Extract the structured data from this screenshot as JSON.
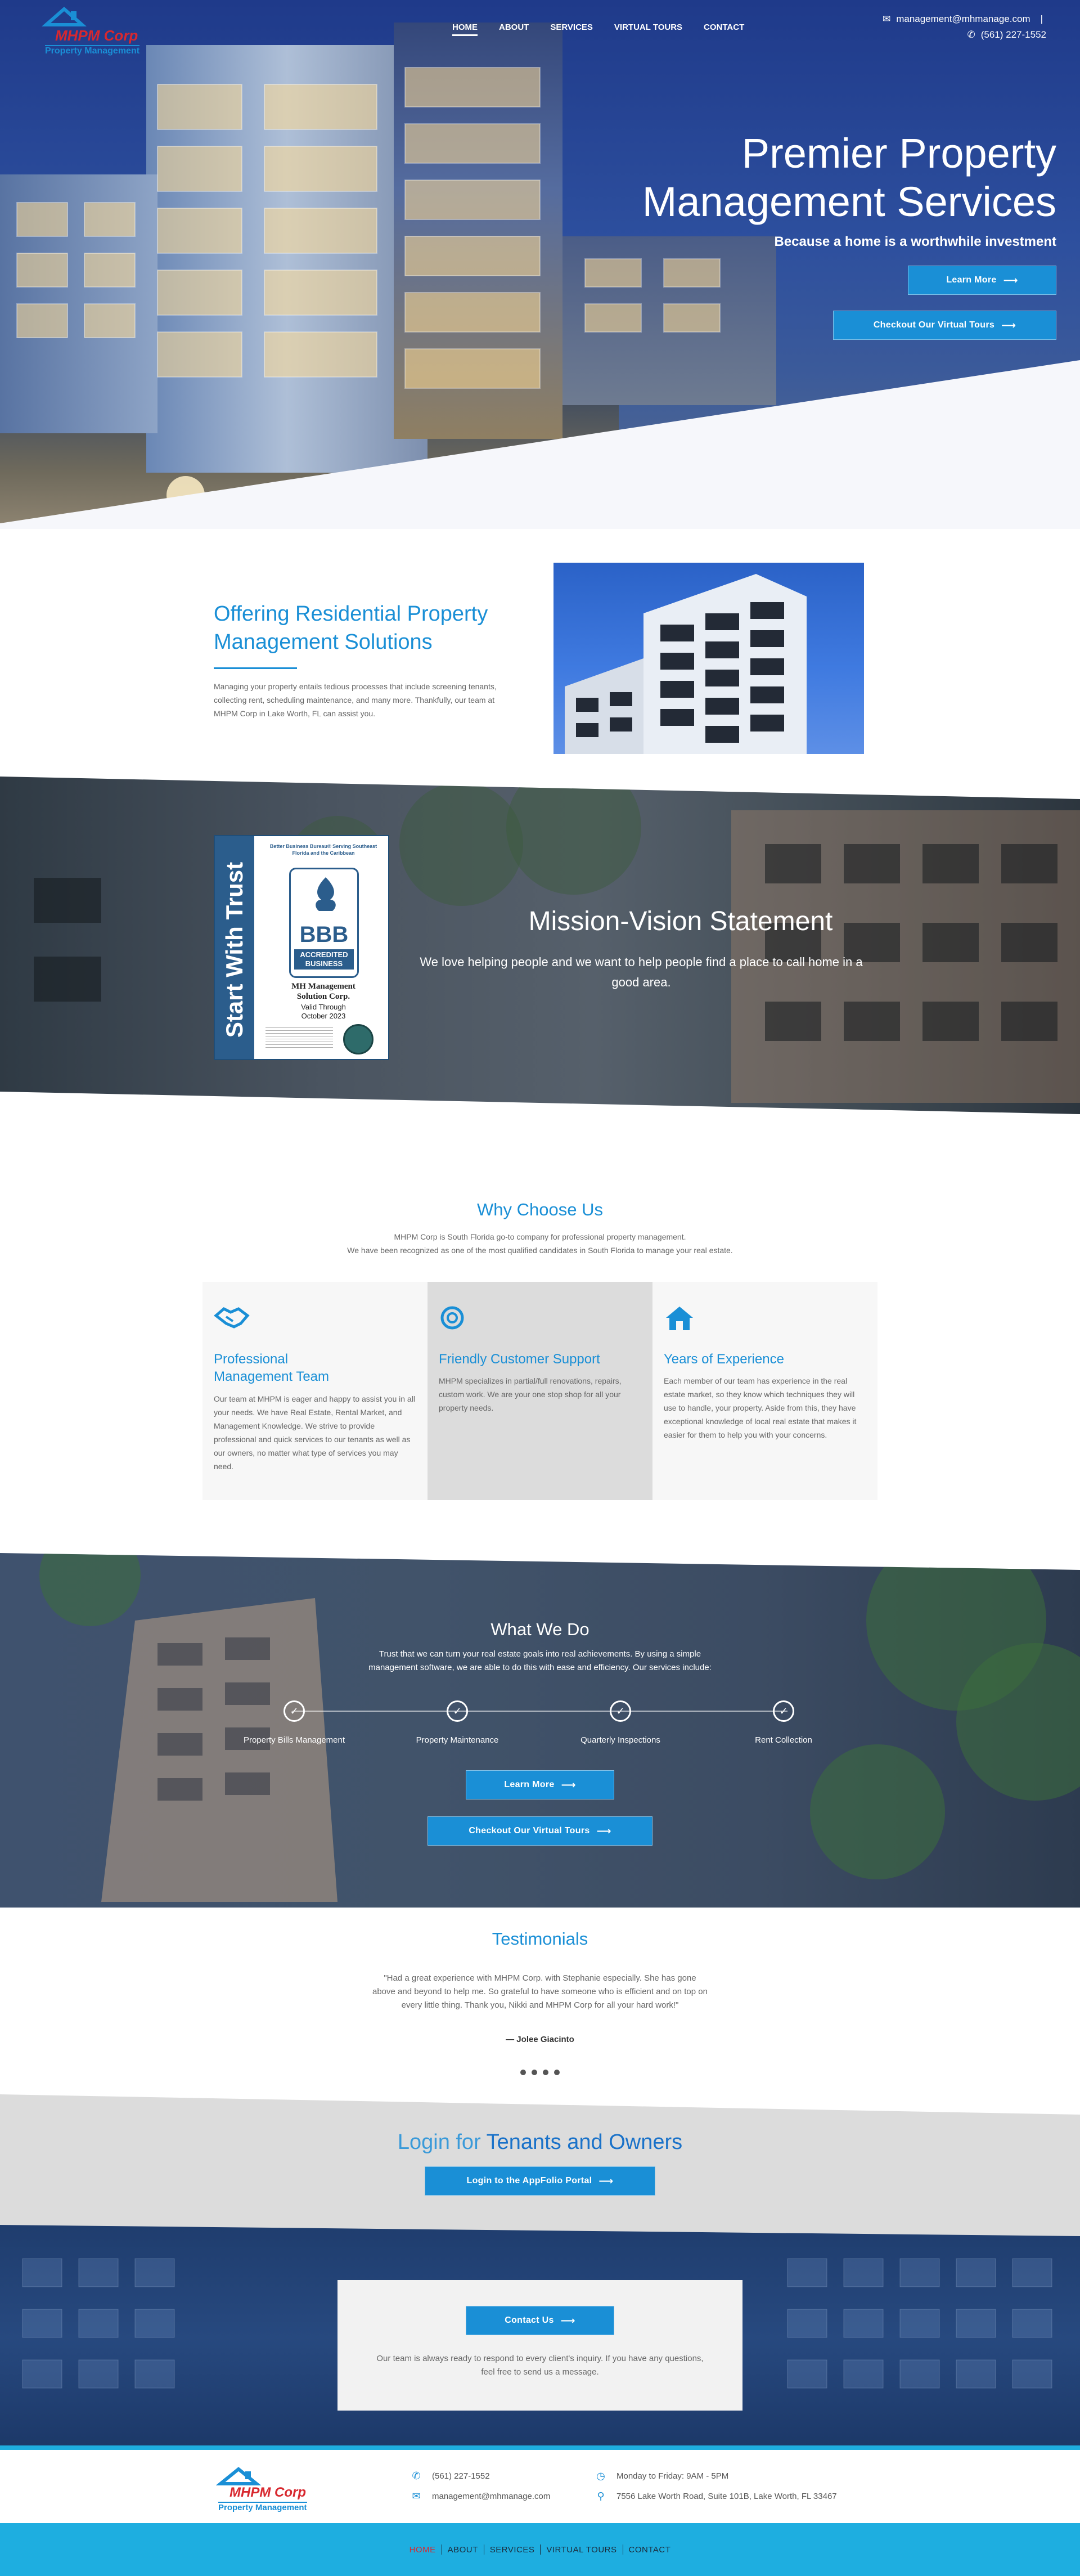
{
  "header": {
    "logo_name": "MHPM Corp",
    "logo_sub": "Property Management",
    "nav": [
      "HOME",
      "ABOUT",
      "SERVICES",
      "VIRTUAL TOURS",
      "CONTACT"
    ],
    "active_nav": "HOME",
    "email": "management@mhmanage.com",
    "phone": "(561) 227-1552"
  },
  "hero": {
    "title_line1": "Premier Property",
    "title_line2": "Management Services",
    "subtitle": "Because a home is a worthwhile investment",
    "btn_learn": "Learn More",
    "btn_tours": "Checkout Our Virtual Tours"
  },
  "offering": {
    "title_line1": "Offering Residential Property",
    "title_line2": "Management Solutions",
    "body": "Managing your property entails tedious processes that include screening tenants, collecting rent, scheduling maintenance, and many more. Thankfully, our team at MHPM Corp in Lake Worth, FL can assist you."
  },
  "mission": {
    "badge_vertical": "Start With Trust",
    "badge_bbb_header": "Better Business Bureau® Serving Southeast Florida and the Caribbean",
    "badge_bbb": "BBB",
    "badge_accredited_line1": "ACCREDITED",
    "badge_accredited_line2": "BUSINESS",
    "badge_company_line1": "MH Management",
    "badge_company_line2": "Solution Corp.",
    "badge_valid": "Valid Through",
    "badge_date": "October 2023",
    "title": "Mission-Vision Statement",
    "body": "We love helping people and we want to help people find a place to call home in a good area."
  },
  "why": {
    "title_a": "Why",
    "title_b": "Choose Us",
    "intro_line1": "MHPM Corp is South Florida go-to company for professional property management.",
    "intro_line2": "We have been recognized as one of the most qualified candidates in South Florida to manage your real estate.",
    "cards": [
      {
        "icon": "handshake-icon",
        "glyph": "🤝",
        "title_a": "Professional",
        "title_b": "Management Team",
        "body": "Our team at MHPM is eager and happy to assist you in all your needs. We have Real Estate, Rental Market, and Management Knowledge. We strive to provide professional and quick services to our tenants as well as our owners, no matter what type of services you may need."
      },
      {
        "icon": "lifebuoy-icon",
        "glyph": "◎",
        "title_a": "Friendly",
        "title_b": "Customer Support",
        "body": "MHPM specializes in partial/full renovations, repairs, custom work. We are your one stop shop for all your property needs."
      },
      {
        "icon": "home-icon",
        "glyph": "⌂",
        "title_a": "Years of",
        "title_b": "Experience",
        "body": "Each member of our team has experience in the real estate market, so they know which techniques they will use to handle, your property. Aside from this, they have exceptional knowledge of local real estate that makes it easier for them to help you with your concerns."
      }
    ]
  },
  "what": {
    "title": "What We Do",
    "body": "Trust that we can turn your real estate goals into real achievements. By using a simple management software, we are able to do this with ease and efficiency. Our services include:",
    "services": [
      "Property Bills Management",
      "Property Maintenance",
      "Quarterly Inspections",
      "Rent Collection"
    ],
    "btn_learn": "Learn More",
    "btn_tours": "Checkout Our Virtual Tours"
  },
  "testimonials": {
    "title": "Testimonials",
    "quote": "\"Had a great experience with MHPM Corp. with Stephanie especially. She has gone above and beyond to help me. So grateful to have someone who is efficient and on top on every little thing. Thank you, Nikki and MHPM Corp for all your hard work!\"",
    "author": "— Jolee Giacinto"
  },
  "login": {
    "title_a": "Login for",
    "title_b": "Tenants and Owners",
    "button": "Login to the AppFolio Portal"
  },
  "contact": {
    "button": "Contact Us",
    "body": "Our team is always ready to respond to every client's inquiry. If you have any questions, feel free to send us a message."
  },
  "footer": {
    "phone": "(561) 227-1552",
    "email": "management@mhmanage.com",
    "hours": "Monday to Friday: 9AM - 5PM",
    "address": "7556 Lake Worth Road, Suite 101B, Lake Worth, FL 33467",
    "nav": [
      "HOME",
      "ABOUT",
      "SERVICES",
      "VIRTUAL TOURS",
      "CONTACT"
    ]
  },
  "colors": {
    "accent": "#1a8fd6",
    "heading_blue": "#1a8fd6",
    "logo_red": "#d8282f",
    "footer_bar": "#1eaee0",
    "hero_sky": "#1f3a8a"
  }
}
